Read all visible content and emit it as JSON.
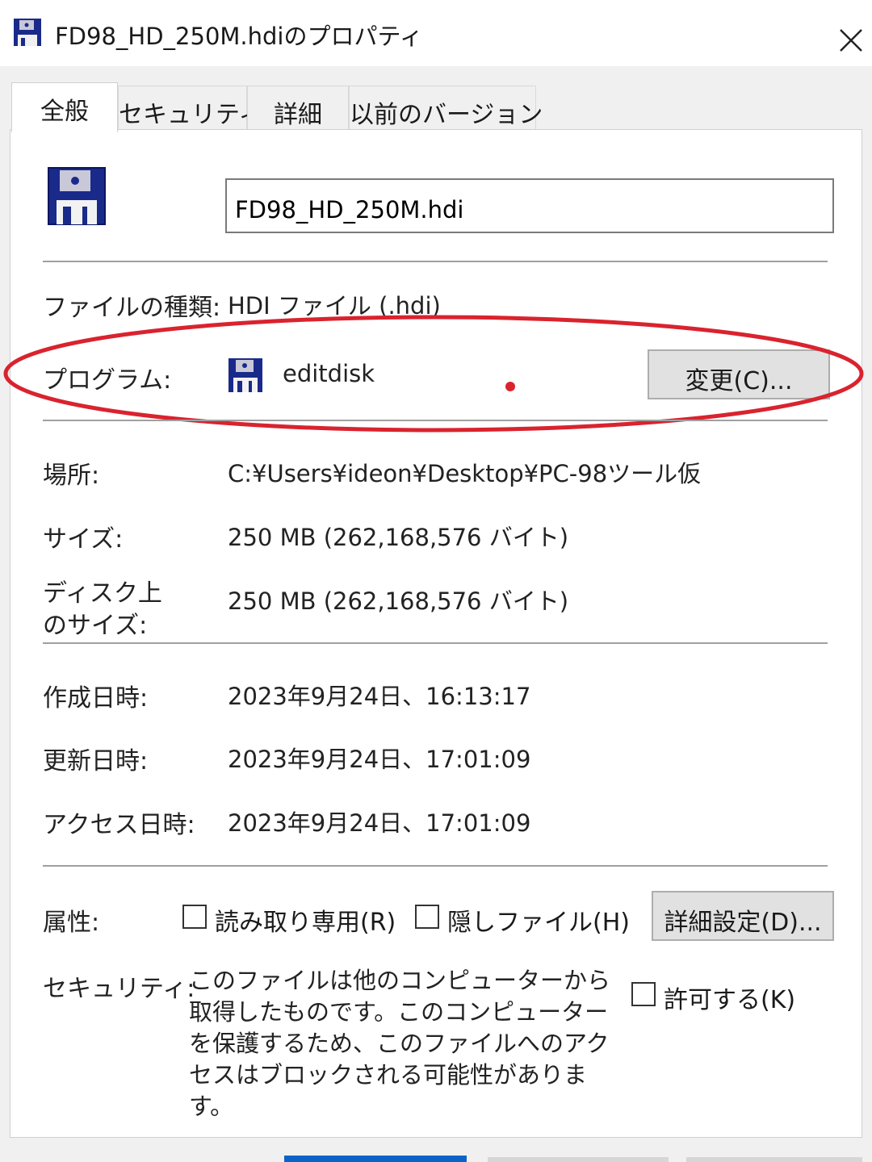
{
  "window": {
    "title": "FD98_HD_250M.hdiのプロパティ"
  },
  "tabs": [
    {
      "label": "全般",
      "active": true
    },
    {
      "label": "セキュリティ",
      "active": false
    },
    {
      "label": "詳細",
      "active": false
    },
    {
      "label": "以前のバージョン",
      "active": false
    }
  ],
  "general": {
    "file_name": "FD98_HD_250M.hdi",
    "file_type_label": "ファイルの種類:",
    "file_type_value": "HDI ファイル (.hdi)",
    "program_label": "プログラム:",
    "program_name": "editdisk",
    "change_button": "変更(C)...",
    "location_label": "場所:",
    "location_value": "C:¥Users¥ideon¥Desktop¥PC-98ツール仮",
    "size_label": "サイズ:",
    "size_value": "250 MB (262,168,576 バイト)",
    "disk_size_label_line1": "ディスク上",
    "disk_size_label_line2": "のサイズ:",
    "disk_size_value": "250 MB (262,168,576 バイト)",
    "created_label": "作成日時:",
    "created_value": "2023年9月24日、16:13:17",
    "modified_label": "更新日時:",
    "modified_value": "2023年9月24日、17:01:09",
    "accessed_label": "アクセス日時:",
    "accessed_value": "2023年9月24日、17:01:09",
    "attributes_label": "属性:",
    "readonly_label": "読み取り専用(R)",
    "hidden_label": "隠しファイル(H)",
    "advanced_button": "詳細設定(D)...",
    "security_label": "セキュリティ:",
    "security_note": "このファイルは他のコンピューターから取得したものです。このコンピューターを保護するため、このファイルへのアクセスはブロックされる可能性があります。",
    "unblock_label": "許可する(K)"
  },
  "colors": {
    "annotation_ellipse": "#d9232e",
    "floppy_body": "#1a2a8a",
    "button_bg": "#e1e1e1",
    "accent": "#0a64c8"
  }
}
